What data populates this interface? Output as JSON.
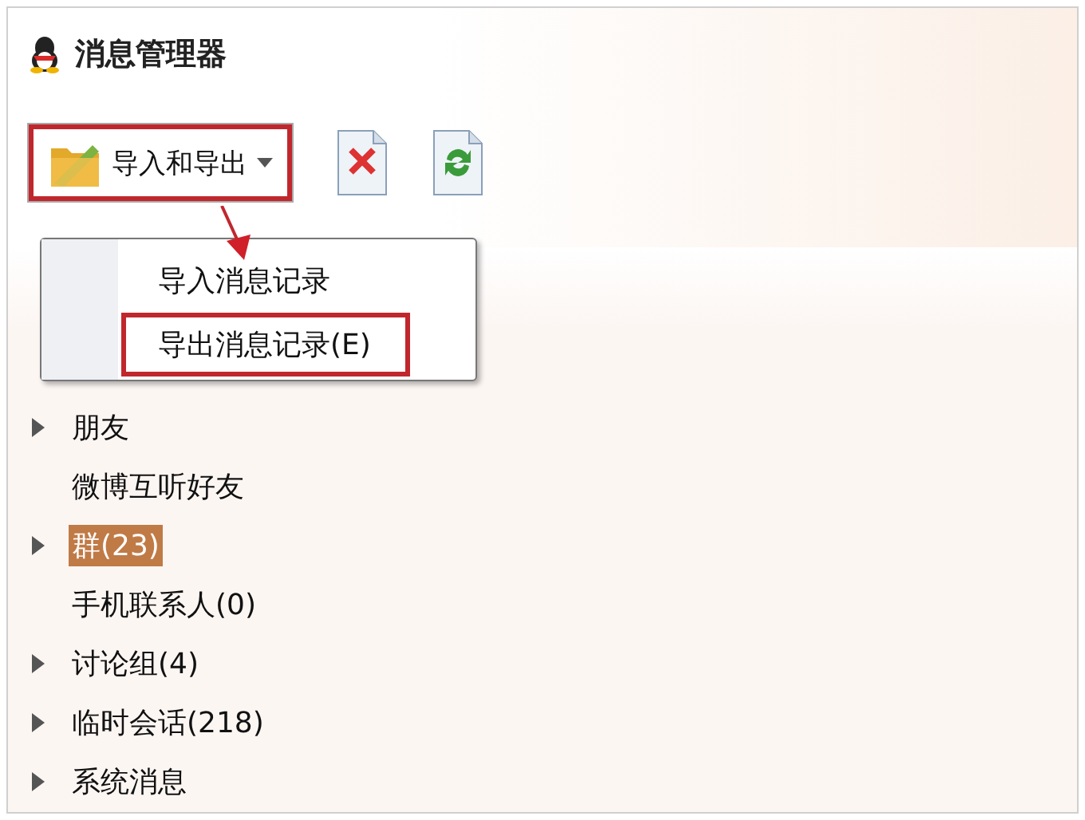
{
  "window": {
    "title": "消息管理器"
  },
  "toolbar": {
    "menu_button": {
      "label": "导入和导出",
      "highlighted": true,
      "expanded": true
    },
    "tools": [
      {
        "kind": "delete"
      },
      {
        "kind": "refresh"
      }
    ]
  },
  "menu": {
    "items": [
      {
        "label": "导入消息记录",
        "highlighted": false
      },
      {
        "label": "导出消息记录(E)",
        "highlighted": true
      }
    ]
  },
  "tree": {
    "items": [
      {
        "label": "朋友",
        "expandable": true,
        "selected": false
      },
      {
        "label": "微博互听好友",
        "expandable": false,
        "selected": false
      },
      {
        "label": "群(23)",
        "expandable": true,
        "selected": true
      },
      {
        "label": "手机联系人(0)",
        "expandable": false,
        "selected": false
      },
      {
        "label": "讨论组(4)",
        "expandable": true,
        "selected": false
      },
      {
        "label": "临时会话(218)",
        "expandable": true,
        "selected": false
      },
      {
        "label": "系统消息",
        "expandable": true,
        "selected": false
      }
    ]
  }
}
